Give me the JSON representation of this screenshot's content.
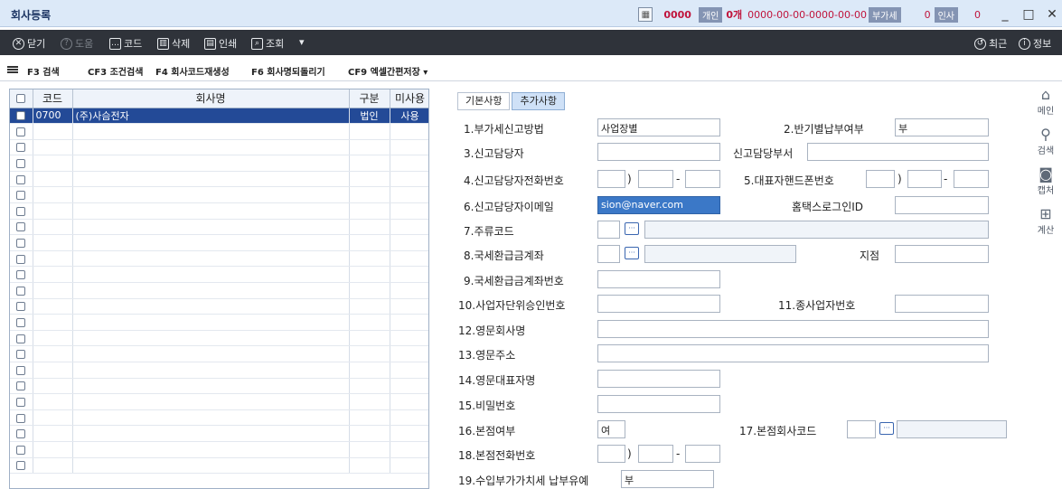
{
  "window": {
    "title": "회사등록",
    "calc_icon": "calculator-icon",
    "code": "0000",
    "personal_tag": "개인",
    "personal_count": "0개",
    "phone_mask": "0000-00-00-0000-00-00",
    "vat_tag": "부가세",
    "vat_count": "0",
    "hr_tag": "인사",
    "hr_count": "0",
    "minimize": "_",
    "maximize": "□",
    "close": "✕"
  },
  "toolbar": {
    "close": "닫기",
    "help": "도움",
    "code": "코드",
    "delete": "삭제",
    "print": "인쇄",
    "query": "조회",
    "more": "▾",
    "recent": "최근",
    "info": "정보"
  },
  "fkeys": {
    "f3": "F3 검색",
    "cf3": "CF3 조건검색",
    "f4": "F4 회사코드재생성",
    "f6": "F6 회사명되돌리기",
    "cf9": "CF9 엑셀간편저장 ▾"
  },
  "grid": {
    "headers": {
      "code": "코드",
      "name": "회사명",
      "type": "구분",
      "unused": "미사용"
    },
    "rows": [
      {
        "code": "0700",
        "name": "(주)사슴전자",
        "type": "법인",
        "unused": "사용"
      }
    ]
  },
  "tabs": {
    "basic": "기본사항",
    "additional": "추가사항"
  },
  "form": {
    "vat_method_label": "1.부가세신고방법",
    "vat_method_value": "사업장별",
    "half_pay_label": "2.반기별납부여부",
    "half_pay_value": "부",
    "reporter_label": "3.신고담당자",
    "reporter_dept_label": "신고담당부서",
    "reporter_phone_label": "4.신고담당자전화번호",
    "paren": ")",
    "dash": "-",
    "ceo_mobile_label": "5.대표자핸드폰번호",
    "reporter_email_label": "6.신고담당자이메일",
    "reporter_email_value": "sion@naver.com",
    "hometax_label": "홈택스로그인ID",
    "liquor_label": "7.주류코드",
    "refund_account_label": "8.국세환급금계좌",
    "branch_label": "지점",
    "refund_number_label": "9.국세환급금계좌번호",
    "biz_unit_label": "10.사업자단위승인번호",
    "sub_biz_label": "11.종사업자번호",
    "eng_name_label": "12.영문회사명",
    "eng_address_label": "13.영문주소",
    "eng_ceo_label": "14.영문대표자명",
    "password_label": "15.비밀번호",
    "head_office_label": "16.본점여부",
    "head_office_value": "여",
    "head_code_label": "17.본점회사코드",
    "head_phone_label": "18.본점전화번호",
    "import_vat_label": "19.수입부가가치세 납부유예",
    "import_vat_value": "부"
  },
  "rightbar": {
    "main": "메인",
    "search": "검색",
    "capture": "캡처",
    "calc": "계산"
  }
}
